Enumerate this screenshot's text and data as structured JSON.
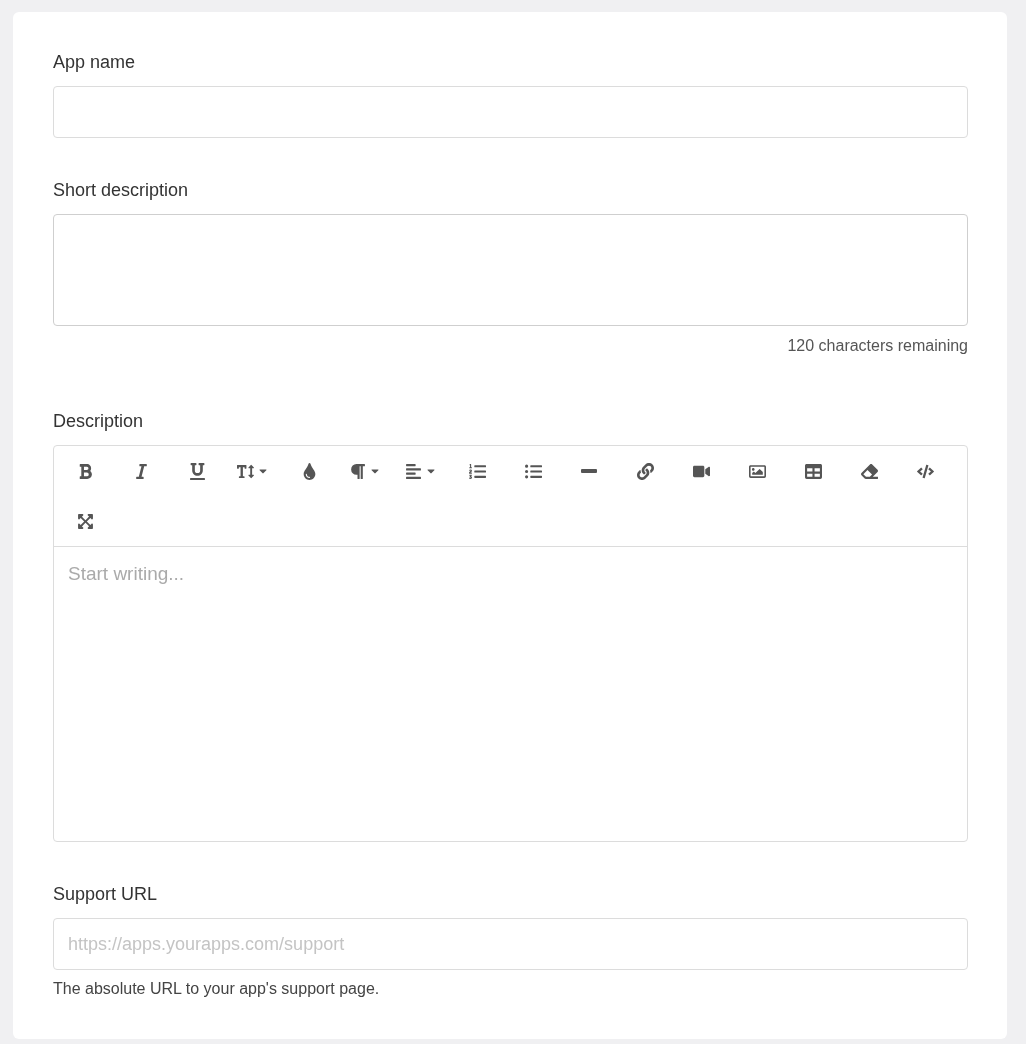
{
  "fields": [
    {
      "kind": "input",
      "label": "App name"
    },
    {
      "kind": "textarea",
      "label": "Short description",
      "counter": "120 characters remaining"
    },
    {
      "kind": "editor",
      "label": "Description",
      "placeholder": "Start writing...",
      "toolbar": [
        {
          "kind": "bold",
          "dropdown": false
        },
        {
          "kind": "italic",
          "dropdown": false
        },
        {
          "kind": "underline",
          "dropdown": false
        },
        {
          "kind": "text-height",
          "dropdown": true
        },
        {
          "kind": "color",
          "dropdown": false
        },
        {
          "kind": "paragraph",
          "dropdown": true
        },
        {
          "kind": "align",
          "dropdown": true
        },
        {
          "kind": "ordered-list",
          "dropdown": false
        },
        {
          "kind": "bullet-list",
          "dropdown": false
        },
        {
          "kind": "rule",
          "dropdown": false
        },
        {
          "kind": "link",
          "dropdown": false
        },
        {
          "kind": "video",
          "dropdown": false
        },
        {
          "kind": "image",
          "dropdown": false
        },
        {
          "kind": "table",
          "dropdown": false
        },
        {
          "kind": "eraser",
          "dropdown": false
        },
        {
          "kind": "code",
          "dropdown": false
        },
        {
          "kind": "fullscreen",
          "dropdown": false
        }
      ]
    },
    {
      "kind": "input",
      "label": "Support URL",
      "placeholder": "https://apps.yourapps.com/support",
      "help": "The absolute URL to your app's support page."
    }
  ]
}
